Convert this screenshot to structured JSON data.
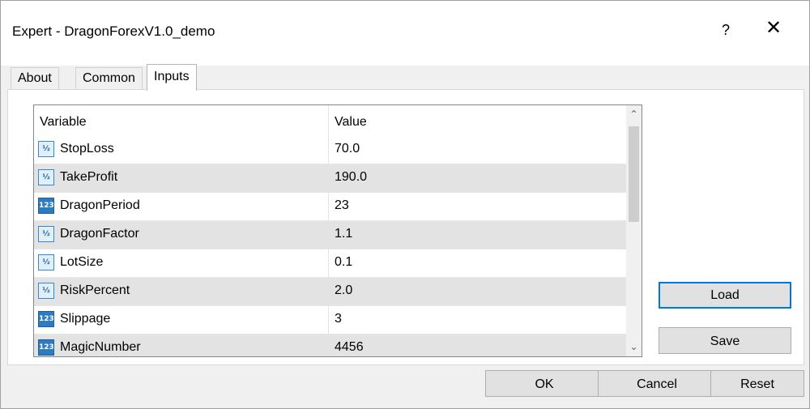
{
  "window": {
    "title": "Expert - DragonForexV1.0_demo",
    "help_label": "?",
    "close_label": "✕"
  },
  "tabs": [
    {
      "label": "About",
      "active": false
    },
    {
      "label": "Common",
      "active": false
    },
    {
      "label": "Inputs",
      "active": true
    }
  ],
  "grid": {
    "headers": {
      "variable": "Variable",
      "value": "Value"
    },
    "rows": [
      {
        "name": "StopLoss",
        "value": "70.0",
        "type": "double-icon"
      },
      {
        "name": "TakeProfit",
        "value": "190.0",
        "type": "double-icon"
      },
      {
        "name": "DragonPeriod",
        "value": "23",
        "type": "int-icon"
      },
      {
        "name": "DragonFactor",
        "value": "1.1",
        "type": "double-icon"
      },
      {
        "name": "LotSize",
        "value": "0.1",
        "type": "double-icon"
      },
      {
        "name": "RiskPercent",
        "value": "2.0",
        "type": "double-icon"
      },
      {
        "name": "Slippage",
        "value": "3",
        "type": "int-icon"
      },
      {
        "name": "MagicNumber",
        "value": "4456",
        "type": "int-icon"
      }
    ]
  },
  "side_buttons": {
    "load": "Load",
    "save": "Save"
  },
  "footer_buttons": {
    "ok": "OK",
    "cancel": "Cancel",
    "reset": "Reset"
  },
  "colors": {
    "accent": "#0078d7",
    "alt_row": "#e3e3e3"
  }
}
